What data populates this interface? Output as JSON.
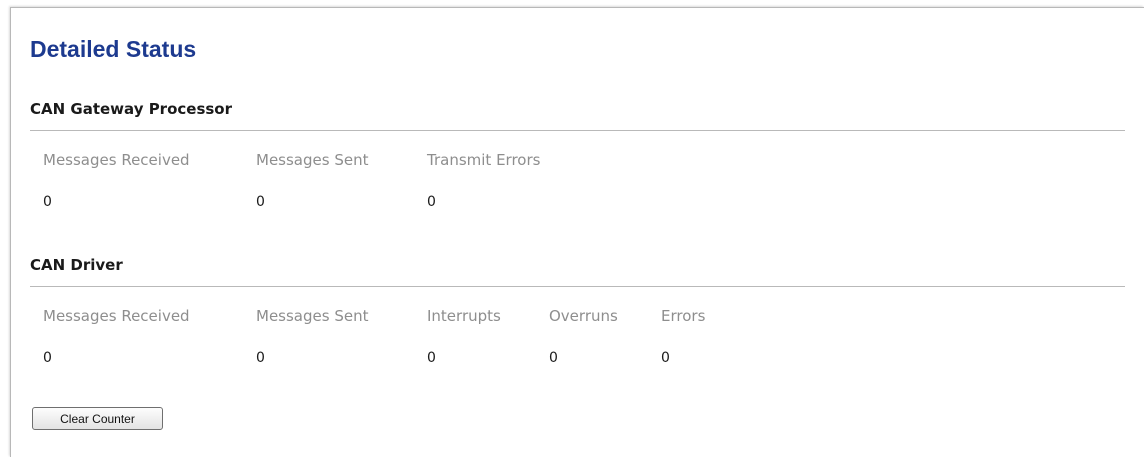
{
  "page": {
    "title": "Detailed Status"
  },
  "gateway": {
    "title": "CAN Gateway Processor",
    "headers": [
      "Messages Received",
      "Messages Sent",
      "Transmit Errors"
    ],
    "values": [
      "0",
      "0",
      "0"
    ]
  },
  "driver": {
    "title": "CAN Driver",
    "headers": [
      "Messages Received",
      "Messages Sent",
      "Interrupts",
      "Overruns",
      "Errors"
    ],
    "values": [
      "0",
      "0",
      "0",
      "0",
      "0"
    ]
  },
  "actions": {
    "clear_label": "Clear Counter"
  },
  "colors": {
    "title_blue": "#1d3a8f",
    "header_gray": "#8e8e8e",
    "rule_gray": "#b9b9b9"
  }
}
